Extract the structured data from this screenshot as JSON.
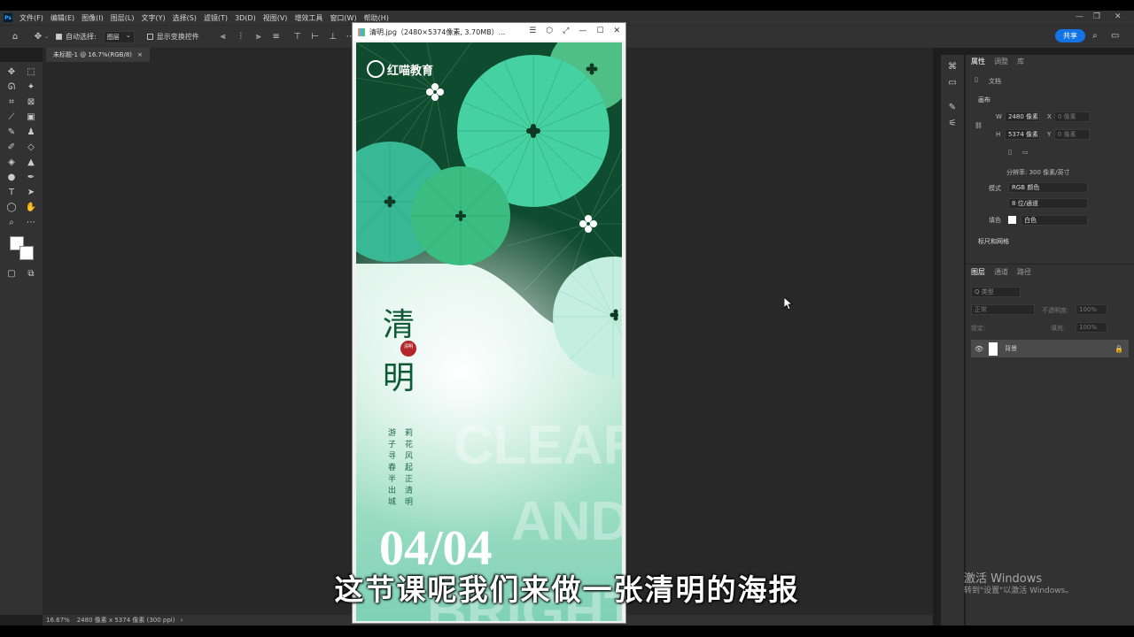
{
  "app": {
    "logo": "Ps"
  },
  "menu": [
    "文件(F)",
    "编辑(E)",
    "图像(I)",
    "图层(L)",
    "文字(Y)",
    "选择(S)",
    "滤镜(T)",
    "3D(D)",
    "视图(V)",
    "增效工具",
    "窗口(W)",
    "帮助(H)"
  ],
  "options": {
    "auto_select_label": "自动选择:",
    "auto_select_value": "图层",
    "show_transform_label": "显示变换控件",
    "share_label": "共享"
  },
  "document_tab": {
    "label": "未标题-1 @ 16.7%(RGB/8)",
    "close": "×"
  },
  "status": {
    "zoom": "16.67%",
    "info": "2480 像素 x 5374 像素 (300 ppi)",
    "arrow": "›"
  },
  "doc_window": {
    "title": "清明.jpg（2480×5374像素, 3.70MB）...",
    "controls": [
      "☰",
      "⬡",
      "⤢",
      "—",
      "☐",
      "✕"
    ]
  },
  "poster": {
    "brand": "红喵教育",
    "title_top": "清",
    "title_bottom": "明",
    "seal": "清明",
    "poem_col1": "莉花风起正清明",
    "poem_col2": "游子寻春半出城",
    "date": "04/04",
    "bg_text_1": "CLEAR",
    "bg_text_2": "AND",
    "bg_text_3": "BRIGHT"
  },
  "properties": {
    "tabs": [
      "属性",
      "调整",
      "库"
    ],
    "doc_label": "文档",
    "canvas_section": "画布",
    "w_label": "W",
    "w_value": "2480 像素",
    "h_label": "H",
    "h_value": "5374 像素",
    "x_label": "X",
    "x_value": "0 像素",
    "y_label": "Y",
    "y_value": "0 像素",
    "resolution": "分辨率: 300 像素/英寸",
    "mode_label": "模式",
    "mode_value": "RGB 颜色",
    "depth_value": "8 位/通道",
    "fill_label": "填色",
    "fill_value": "白色",
    "rulers_section": "标尺和网格"
  },
  "layers": {
    "tabs": [
      "图层",
      "通道",
      "路径"
    ],
    "search_placeholder": "Q 类型",
    "blend_value": "正常",
    "opacity_label": "不透明度:",
    "opacity_value": "100%",
    "lock_label": "锁定:",
    "fill_label": "填充:",
    "fill_value": "100%",
    "layer_name": "背景"
  },
  "subtitle": "这节课呢我们来做一张清明的海报",
  "watermark": {
    "line1": "激活 Windows",
    "line2": "转到\"设置\"以激活 Windows。"
  },
  "colors": {
    "ps_blue": "#31a8ff",
    "share_blue": "#1473e6",
    "dark_green": "#0e4a2c",
    "mid_green": "#3fcf9c",
    "light_green": "#7fe0bf",
    "pale_green": "#c7efe0"
  }
}
